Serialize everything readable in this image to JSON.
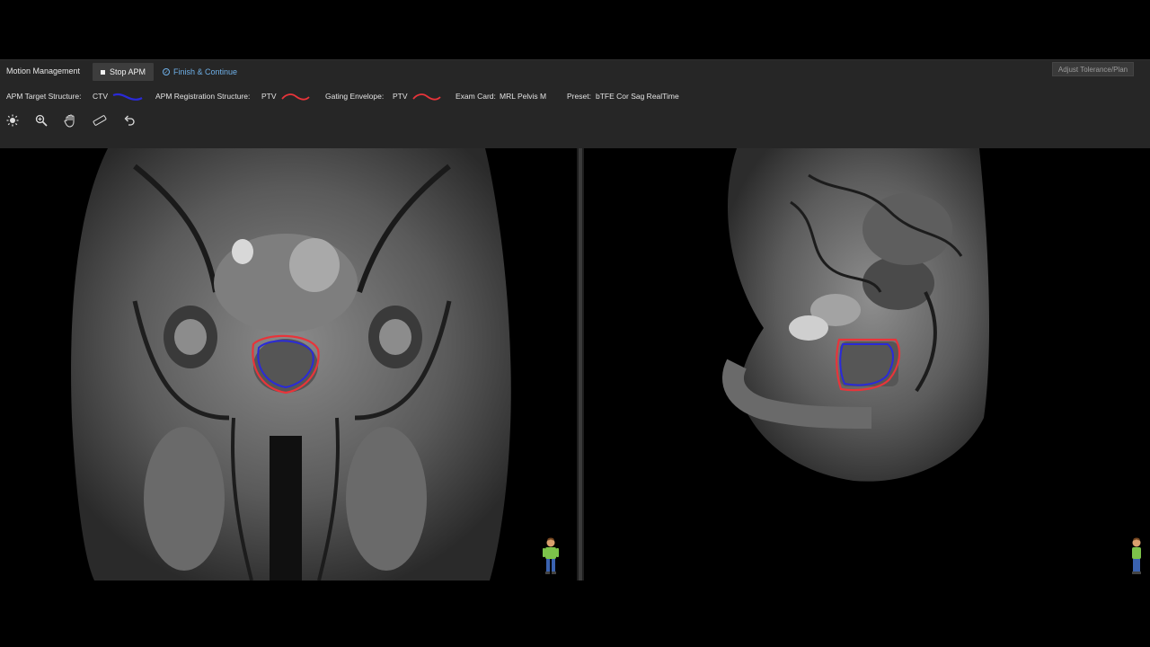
{
  "app": {
    "title": "Motion Management"
  },
  "toolbar": {
    "stop_label": "Stop APM",
    "finish_label": "Finish & Continue",
    "adjust_label": "Adjust Tolerance/Plan"
  },
  "info": {
    "target_label": "APM Target Structure:",
    "target_value": "CTV",
    "registration_label": "APM Registration Structure:",
    "registration_value": "PTV",
    "gating_label": "Gating Envelope:",
    "gating_value": "PTV",
    "exam_label": "Exam Card:",
    "exam_value": "MRL Pelvis M",
    "preset_label": "Preset:",
    "preset_value": "bTFE Cor Sag RealTime"
  },
  "colors": {
    "ctv": "#2a2ad8",
    "ptv": "#e8343a",
    "accent": "#6fb0e8",
    "toolbar_bg": "#262626"
  },
  "tools": [
    {
      "name": "brightness-icon"
    },
    {
      "name": "zoom-icon"
    },
    {
      "name": "pan-hand-icon"
    },
    {
      "name": "ruler-icon"
    },
    {
      "name": "undo-icon"
    }
  ],
  "views": {
    "left": "coronal",
    "right": "sagittal"
  }
}
